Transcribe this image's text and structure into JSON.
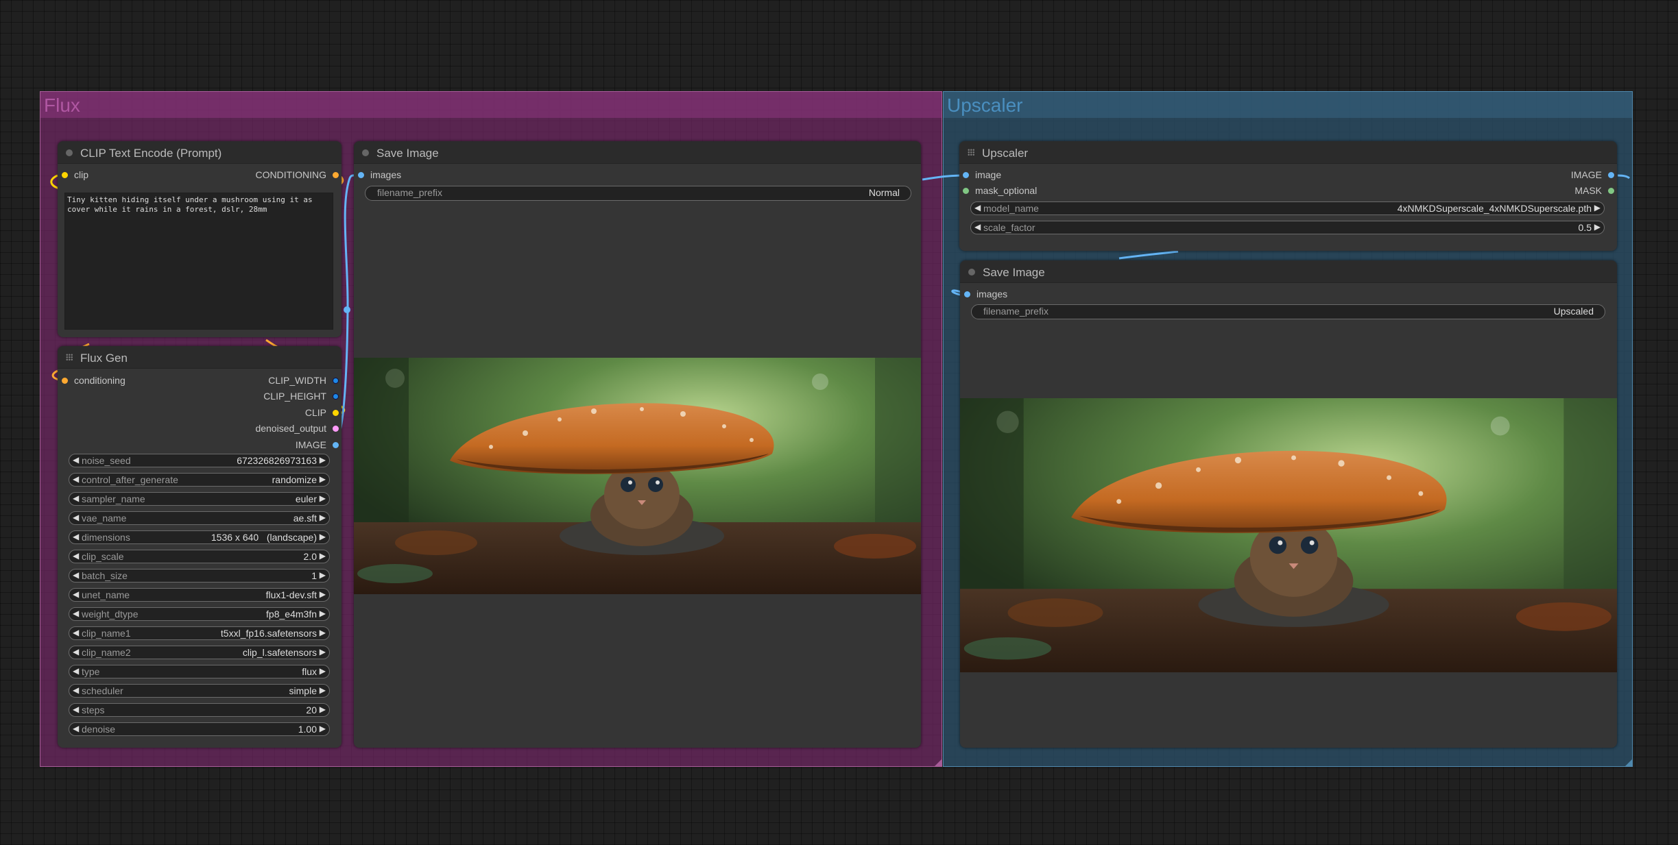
{
  "groups": {
    "flux": "Flux",
    "upscaler": "Upscaler"
  },
  "colors": {
    "flux_group": "#6f2763",
    "upscaler_group": "#2a4e66",
    "clip_wire": "#ffd500",
    "conditioning_wire": "#ffa931",
    "image_wire": "#64b5f6",
    "mask_pin": "#81c784",
    "latent_pin": "#ff9cf9"
  },
  "clip_node": {
    "title": "CLIP Text Encode (Prompt)",
    "input": "clip",
    "output": "CONDITIONING",
    "prompt": "Tiny kitten hiding itself under a mushroom using it as cover while it rains in a forest, dslr, 28mm"
  },
  "flux_gen": {
    "title": "Flux Gen",
    "input": "conditioning",
    "outputs": [
      "CLIP_WIDTH",
      "CLIP_HEIGHT",
      "CLIP",
      "denoised_output",
      "IMAGE"
    ],
    "widgets": [
      {
        "label": "noise_seed",
        "value": "672326826973163"
      },
      {
        "label": "control_after_generate",
        "value": "randomize"
      },
      {
        "label": "sampler_name",
        "value": "euler"
      },
      {
        "label": "vae_name",
        "value": "ae.sft"
      },
      {
        "label": "dimensions",
        "value": "1536 x 640   (landscape)"
      },
      {
        "label": "clip_scale",
        "value": "2.0"
      },
      {
        "label": "batch_size",
        "value": "1"
      },
      {
        "label": "unet_name",
        "value": "flux1-dev.sft"
      },
      {
        "label": "weight_dtype",
        "value": "fp8_e4m3fn"
      },
      {
        "label": "clip_name1",
        "value": "t5xxl_fp16.safetensors"
      },
      {
        "label": "clip_name2",
        "value": "clip_l.safetensors"
      },
      {
        "label": "type",
        "value": "flux"
      },
      {
        "label": "scheduler",
        "value": "simple"
      },
      {
        "label": "steps",
        "value": "20"
      },
      {
        "label": "denoise",
        "value": "1.00"
      }
    ]
  },
  "save1": {
    "title": "Save Image",
    "input": "images",
    "prefix_label": "filename_prefix",
    "prefix_value": "Normal"
  },
  "upscaler_node": {
    "title": "Upscaler",
    "inputs": [
      "image",
      "mask_optional"
    ],
    "outputs": [
      "IMAGE",
      "MASK"
    ],
    "widgets": [
      {
        "label": "model_name",
        "value": "4xNMKDSuperscale_4xNMKDSuperscale.pth"
      },
      {
        "label": "scale_factor",
        "value": "0.5"
      }
    ]
  },
  "save2": {
    "title": "Save Image",
    "input": "images",
    "prefix_label": "filename_prefix",
    "prefix_value": "Upscaled"
  }
}
